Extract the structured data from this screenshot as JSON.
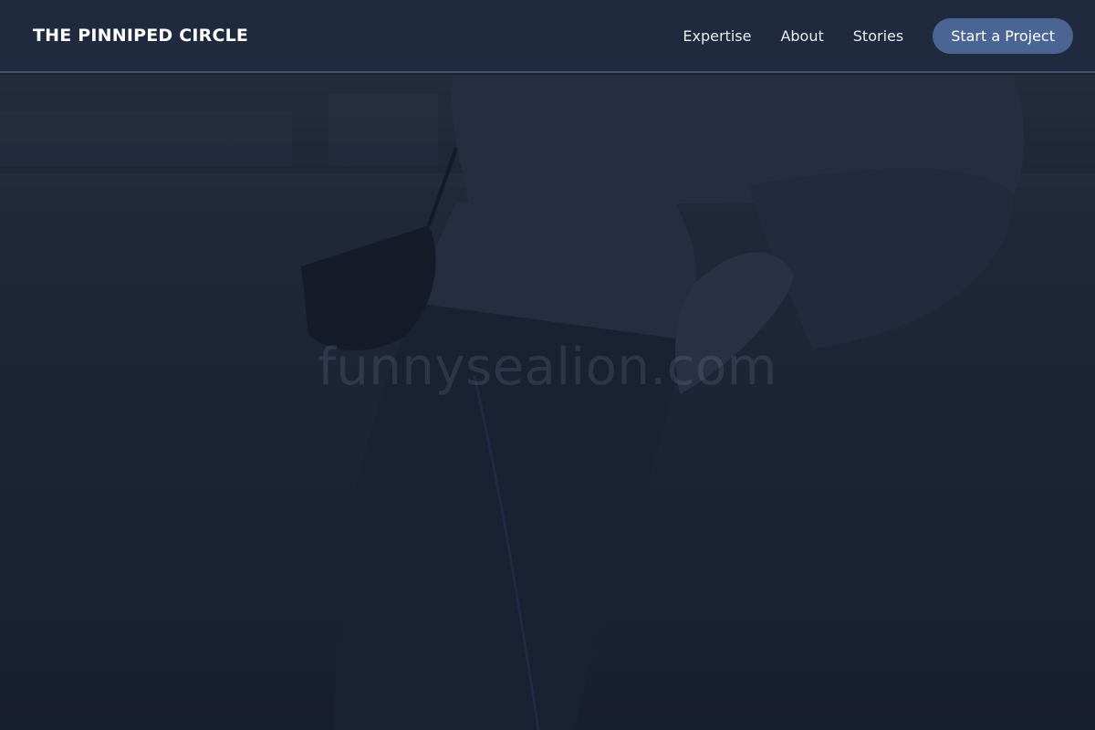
{
  "header": {
    "brand": "THE PINNIPED CIRCLE",
    "nav": [
      {
        "label": "Expertise"
      },
      {
        "label": "About"
      },
      {
        "label": "Stories"
      }
    ],
    "cta_label": "Start a Project"
  },
  "hero": {
    "watermark": "funnysealion.com",
    "image_subject": "person-in-denim-jacket-and-jeans-leaning-on-concrete-wall"
  },
  "colors": {
    "header_bg": "#1f2a3e",
    "header_border": "#3e5274",
    "cta_bg": "#4a6593",
    "hero_overlay": "#1a2132"
  }
}
